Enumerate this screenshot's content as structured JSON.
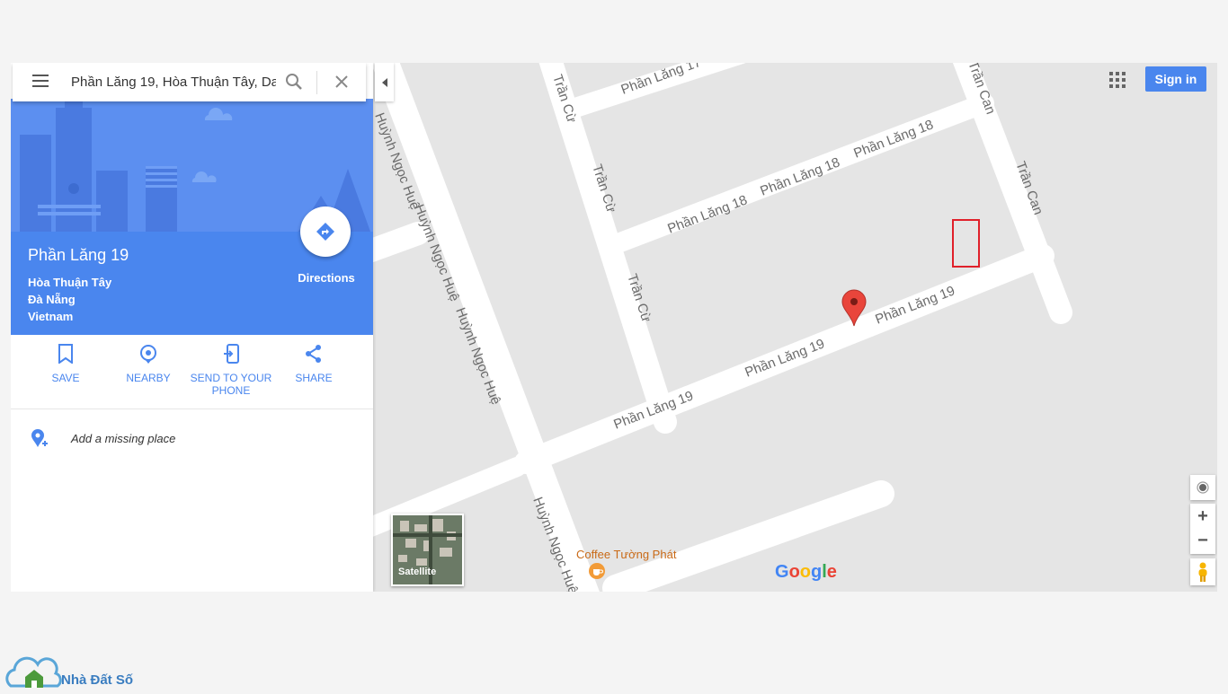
{
  "search": {
    "value": "Phần Lăng 19, Hòa Thuận Tây, Da",
    "menu_icon": "hamburger-menu-icon",
    "search_icon": "search-icon",
    "clear_icon": "close-icon"
  },
  "place": {
    "name": "Phần Lăng 19",
    "address_lines": [
      "Hòa Thuận Tây",
      "Đà Nẵng",
      "Vietnam"
    ],
    "directions_label": "Directions"
  },
  "actions": [
    {
      "label": "SAVE",
      "icon": "bookmark-icon"
    },
    {
      "label": "NEARBY",
      "icon": "location-pin-icon"
    },
    {
      "label": "SEND TO YOUR PHONE",
      "icon": "send-to-phone-icon"
    },
    {
      "label": "SHARE",
      "icon": "share-icon"
    }
  ],
  "add_missing_place": "Add a missing place",
  "header": {
    "sign_in": "Sign in",
    "apps_icon": "apps-grid-icon"
  },
  "map": {
    "road_labels": [
      "Phần Lăng 17",
      "Trần Cừ",
      "Trần Cừ",
      "Trần Cừ",
      "Phần Lăng 18",
      "Phần Lăng 18",
      "Phần Lăng 18",
      "Trần Can",
      "Trần Can",
      "Phần Lăng 19",
      "Phần Lăng 19",
      "Phần Lăng 19",
      "Huỳnh Ngọc Huệ",
      "Huỳnh Ngọc Huệ",
      "Huỳnh Ngọc Huệ",
      "Huỳnh Ngọc Huệ",
      "Huỳnh Ngọc Huệ"
    ],
    "poi": "Coffee Tường Phát",
    "satellite_label": "Satellite",
    "google_logo": "Google",
    "zoom_in": "+",
    "zoom_out": "−"
  },
  "watermark": "Nhà Đất Số",
  "colors": {
    "accent": "#4a86ee",
    "marker": "#e9453b",
    "poi": "#c96a17",
    "highlight_box": "#e0202a"
  }
}
